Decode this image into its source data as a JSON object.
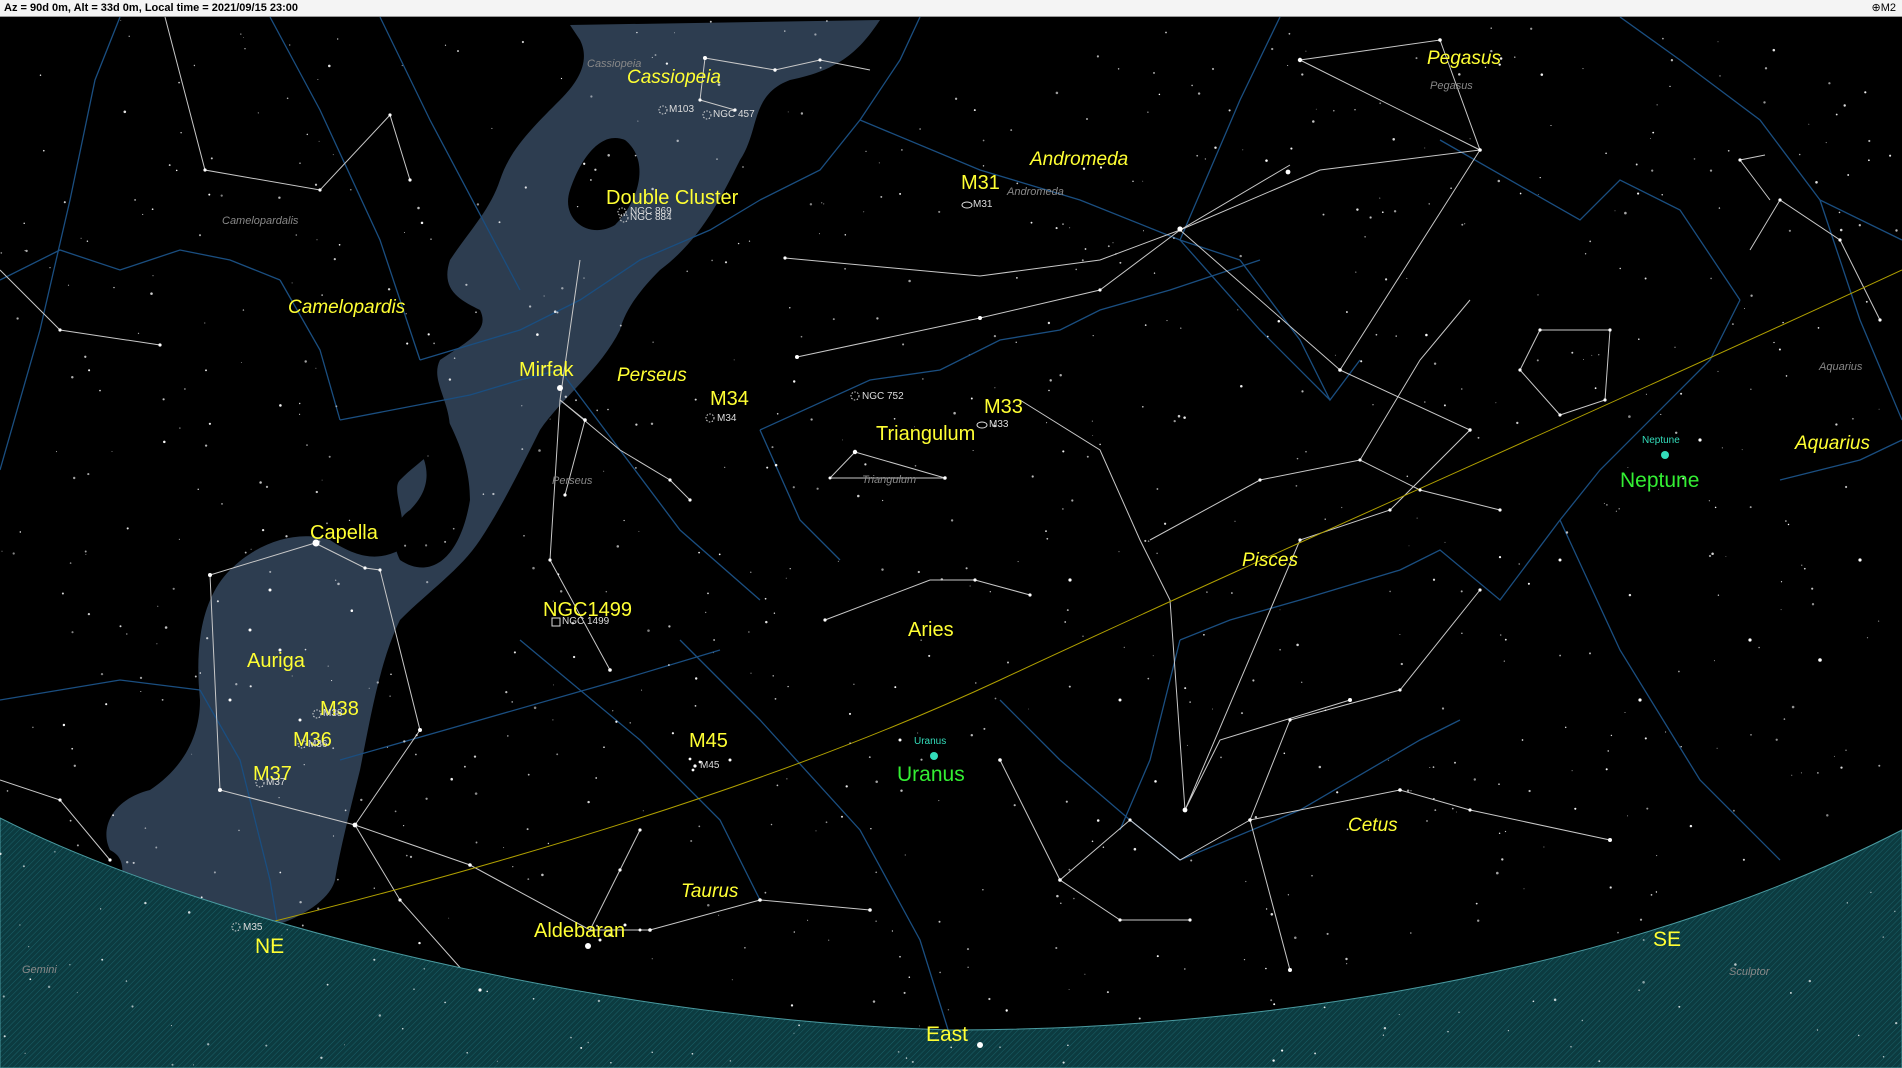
{
  "status_bar": {
    "text": "Az = 90d 0m, Alt = 33d 0m, Local time = 2021/09/15 23:00",
    "corner_label": "⊕M2"
  },
  "constellations": {
    "cassiopeia": "Cassiopeia",
    "andromeda": "Andromeda",
    "pegasus": "Pegasus",
    "camelopardis": "Camelopardis",
    "perseus": "Perseus",
    "triangulum": "Triangulum",
    "aries": "Aries",
    "pisces": "Pisces",
    "aquarius": "Aquarius",
    "auriga": "Auriga",
    "taurus": "Taurus",
    "cetus": "Cetus"
  },
  "constellation_boundary_labels": {
    "cassiopeia": "Cassiopeia",
    "pegasus": "Pegasus",
    "andromeda": "Andromeda",
    "camelopardalis": "Camelopardalis",
    "perseus": "Perseus",
    "triangulum": "Triangulum",
    "aquarius": "Aquarius",
    "gemini": "Gemini",
    "sculptor": "Sculptor"
  },
  "objects": {
    "double_cluster": "Double Cluster",
    "m31": "M31",
    "m33": "M33",
    "m34": "M34",
    "mirfak": "Mirfak",
    "capella": "Capella",
    "ngc1499": "NGC1499",
    "m38": "M38",
    "m36": "M36",
    "m37": "M37",
    "m45": "M45",
    "aldebaran": "Aldebaran"
  },
  "object_tags": {
    "m103": "M103",
    "ngc457": "NGC 457",
    "ngc869": "NGC 869",
    "ngc884": "NGC 884",
    "m31": "M31",
    "m33": "M33",
    "m34": "M34",
    "ngc752": "NGC 752",
    "ngc1499": "NGC 1499",
    "m38": "M38",
    "m36": "M36",
    "m37": "M37",
    "m45": "M45",
    "m35": "M35"
  },
  "planets": {
    "uranus": "Uranus",
    "neptune": "Neptune"
  },
  "directions": {
    "ne": "NE",
    "east": "East",
    "se": "SE"
  },
  "colors": {
    "sky": "#000000",
    "milky_way": "#2d3d50",
    "horizon": "#0c3b40",
    "label": "#ffff33",
    "planet": "#33ee33",
    "ecliptic": "#b0a000",
    "boundary": "#1a4e80",
    "figure": "#cccccc"
  }
}
